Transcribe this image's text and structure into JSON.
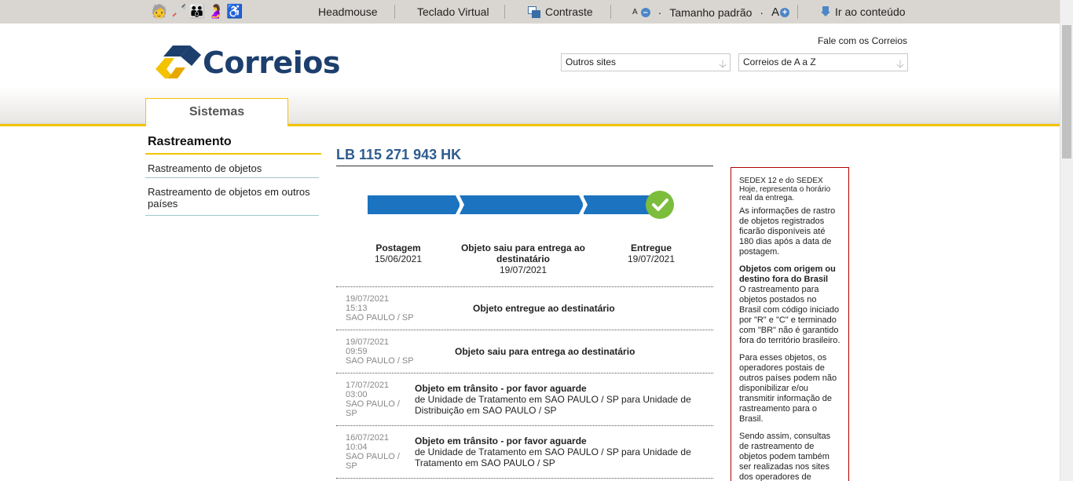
{
  "acc_bar": {
    "headmouse": "Headmouse",
    "teclado": "Teclado Virtual",
    "contraste": "Contraste",
    "font_small": "A",
    "tamanho": "Tamanho padrão",
    "dot": "·",
    "font_big": "A",
    "ir_conteudo": "Ir ao conteúdo"
  },
  "header": {
    "logo_text": "Correios",
    "fale": "Fale com os Correios",
    "select_outros": "Outros sites",
    "select_az": "Correios de A a Z",
    "tab": "Sistemas"
  },
  "menu": {
    "title": "Rastreamento",
    "items": [
      {
        "label": "Rastreamento de objetos"
      },
      {
        "label": "Rastreamento de objetos em outros países"
      }
    ]
  },
  "tracking": {
    "code": "LB 115 271 943 HK",
    "stages": [
      {
        "name": "Postagem",
        "date": "15/06/2021"
      },
      {
        "name": "Objeto saiu para entrega ao destinatário",
        "date": "19/07/2021"
      },
      {
        "name": "Entregue",
        "date": "19/07/2021"
      }
    ],
    "events": [
      {
        "date": "19/07/2021",
        "time": "15:13",
        "place": "SAO PAULO / SP",
        "title": "Objeto entregue ao destinatário",
        "desc": ""
      },
      {
        "date": "19/07/2021",
        "time": "09:59",
        "place": "SAO PAULO / SP",
        "title": "Objeto saiu para entrega ao destinatário",
        "desc": ""
      },
      {
        "date": "17/07/2021",
        "time": "03:00",
        "place": "SAO PAULO / SP",
        "title": "Objeto em trânsito - por favor aguarde",
        "desc": "de Unidade de Tratamento em SAO PAULO / SP para Unidade de Distribuição em SAO PAULO / SP"
      },
      {
        "date": "16/07/2021",
        "time": "10:04",
        "place": "SAO PAULO / SP",
        "title": "Objeto em trânsito - por favor aguarde",
        "desc": "de Unidade de Tratamento em SAO PAULO / SP para Unidade de Tratamento em SAO PAULO / SP"
      }
    ]
  },
  "info_box": {
    "p0": "SEDEX 12 e do SEDEX Hoje, representa o horário real da entrega.",
    "p1": "As informações de rastro de objetos registrados ficarão disponíveis até 180 dias após a data de postagem.",
    "head": "Objetos com origem ou destino fora do Brasil",
    "p2": "O rastreamento para objetos postados no Brasil com código iniciado por \"R\" e \"C\" e terminado com \"BR\" não é garantido fora do território brasileiro.",
    "p3": "Para esses objetos, os operadores postais de outros países podem não disponibilizar e/ou transmitir informação de rastreamento para o Brasil.",
    "p4": "Sendo assim, consultas de rastreamento de objetos podem também ser realizadas nos sites dos operadores de"
  },
  "colors": {
    "brand_blue": "#1d3f6e",
    "brand_yellow": "#f3c300",
    "progress_blue": "#1c73c0",
    "check_green": "#7cbd3c",
    "info_border": "#b30000"
  }
}
